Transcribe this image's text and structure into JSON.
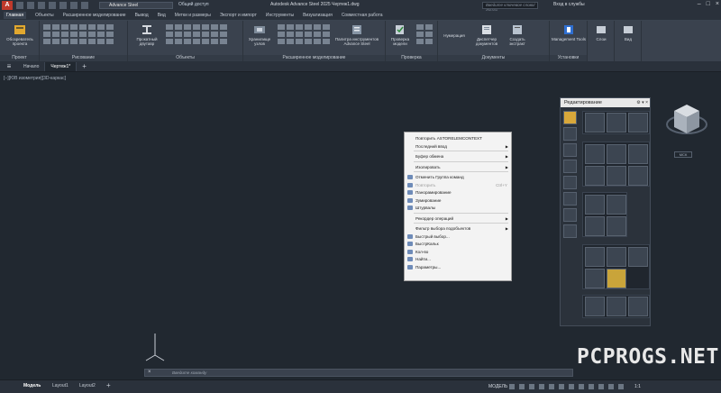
{
  "titlebar": {
    "workspace": "Advance Steel",
    "shared_access": "Общий доступ",
    "app_title": "Autodesk Advance Steel 2025  Чертеж1.dwg",
    "search_placeholder": "Введите ключевое слово/фразу",
    "login": "Вход в службы"
  },
  "ribbon_tabs": [
    "Главная",
    "Объекты",
    "Расширенное моделирование",
    "Вывод",
    "Вид",
    "Метки и размеры",
    "Экспорт и импорт",
    "Инструменты",
    "Визуализация",
    "Совместная работа"
  ],
  "ribbon": {
    "panels": [
      "Проект",
      "Рисование",
      "Объекты",
      "Расширенное моделирование",
      "Проверка",
      "Документы",
      "Установки"
    ],
    "buttons": {
      "project_explorer": "Обозреватель проекта",
      "rolled_beam": "Прокатный двутавр",
      "joint_vault": "Хранилище узлов",
      "tool_palette": "Палитра инструментов Advance Steel",
      "check_model": "Проверка модели",
      "numbering": "Нумерация",
      "doc_manager": "Диспетчер документов",
      "create_bom": "Создать экстракт",
      "mgmt_tools": "Management Tools",
      "layers": "Слои",
      "view": "Вид"
    }
  },
  "doc_tabs": [
    "Начало",
    "Чертеж1*"
  ],
  "viewport_label": "[−][ЮВ изометрия][3D-каркас]",
  "context_menu": {
    "items": [
      {
        "label": "Повторить ASTORELEMCONTEXT"
      },
      {
        "label": "Последний ввод",
        "arrow": true
      },
      {
        "sep": true
      },
      {
        "label": "Буфер обмена",
        "arrow": true
      },
      {
        "sep": true
      },
      {
        "label": "Изолировать",
        "arrow": true
      },
      {
        "sep": true
      },
      {
        "label": "Отменить Группа команд",
        "icon": true
      },
      {
        "label": "Повторить",
        "shortcut": "Ctrl+Y",
        "disabled": true,
        "icon": true
      },
      {
        "label": "Панорамирование",
        "icon": true
      },
      {
        "label": "Зумирование",
        "icon": true
      },
      {
        "label": "Штурвалы",
        "icon": true
      },
      {
        "sep": true
      },
      {
        "label": "Рекордер операций",
        "arrow": true
      },
      {
        "sep": true
      },
      {
        "label": "Фильтр выбора подобъектов",
        "arrow": true
      },
      {
        "label": "Быстрый выбор...",
        "icon": true
      },
      {
        "label": "БыстрКальк",
        "icon": true
      },
      {
        "label": "Кол-во",
        "icon": true
      },
      {
        "label": "Найти...",
        "icon": true
      },
      {
        "label": "Параметры...",
        "icon": true
      }
    ]
  },
  "edit_palette": {
    "title": "Редактирование"
  },
  "viewcube": {
    "wcs": "МСК"
  },
  "command_line": {
    "placeholder": "Введите команду"
  },
  "watermark": "PCPROGS.NET",
  "status": {
    "layout_tabs": [
      "Модель",
      "Layout1",
      "Layout2"
    ],
    "model": "МОДЕЛЬ",
    "scale": "1:1"
  }
}
